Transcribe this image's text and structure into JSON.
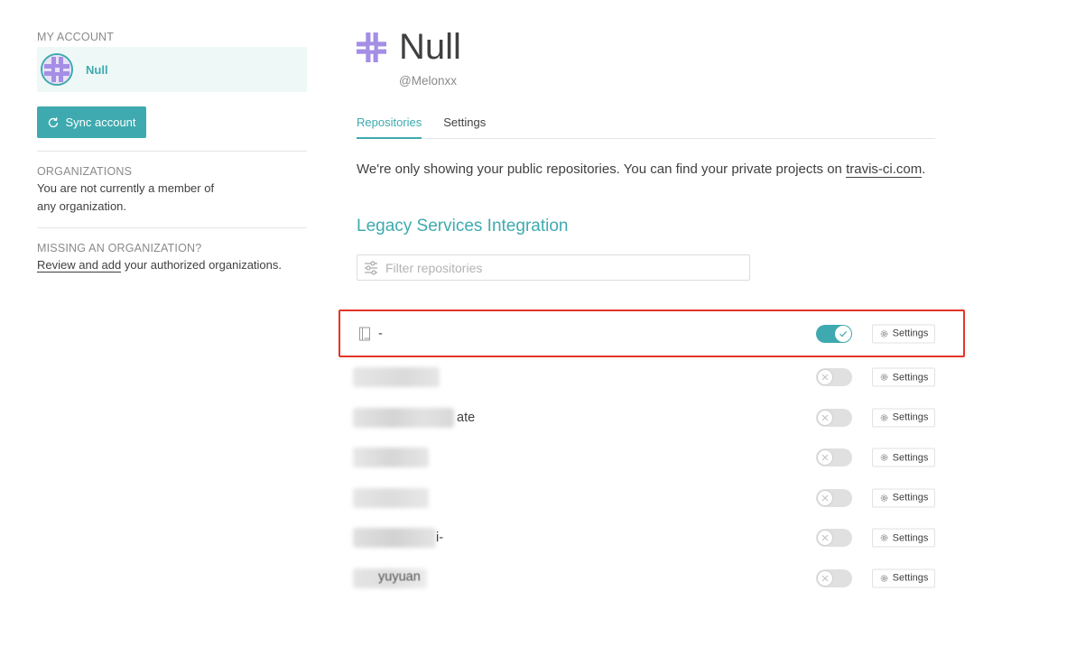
{
  "sidebar": {
    "account_heading": "MY ACCOUNT",
    "account_name": "Null",
    "sync_label": "Sync account",
    "org_heading": "ORGANIZATIONS",
    "org_text_line1": "You are not currently a member of",
    "org_text_line2": "any organization.",
    "missing_heading": "MISSING AN ORGANIZATION?",
    "missing_link": "Review and add",
    "missing_text": " your authorized organizations."
  },
  "profile": {
    "name": "Null",
    "handle": "@Melonxx"
  },
  "tabs": [
    {
      "label": "Repositories",
      "active": true
    },
    {
      "label": "Settings",
      "active": false
    }
  ],
  "notice": {
    "text": "We're only showing your public repositories. You can find your private projects on ",
    "link": "travis-ci.com",
    "suffix": "."
  },
  "section_title": "Legacy Services Integration",
  "filter": {
    "placeholder": "Filter repositories",
    "value": ""
  },
  "repos": [
    {
      "name": "-",
      "enabled": true,
      "settings_label": "Settings",
      "highlighted": true
    },
    {
      "name": "",
      "visible_fragment": "",
      "blurred": true,
      "enabled": false,
      "settings_label": "Settings"
    },
    {
      "name": "",
      "visible_fragment": "ate",
      "blurred": true,
      "enabled": false,
      "settings_label": "Settings"
    },
    {
      "name": "",
      "visible_fragment": "",
      "blurred": true,
      "enabled": false,
      "settings_label": "Settings"
    },
    {
      "name": "",
      "visible_fragment": "",
      "blurred": true,
      "enabled": false,
      "settings_label": "Settings"
    },
    {
      "name": "",
      "visible_fragment": "i-",
      "blurred": true,
      "enabled": false,
      "settings_label": "Settings"
    },
    {
      "name": "",
      "visible_fragment": "yuyuan",
      "blurred": true,
      "enabled": false,
      "settings_label": "Settings"
    }
  ],
  "colors": {
    "accent": "#3eaaaf",
    "highlight_border": "#e33528",
    "avatar_purple": "#a48ee6"
  },
  "icons": {
    "sync": "sync-icon",
    "filter": "filter-sliders-icon",
    "repo": "book-icon",
    "settings": "gear-icon",
    "toggle_on": "check-icon",
    "toggle_off": "x-icon"
  }
}
